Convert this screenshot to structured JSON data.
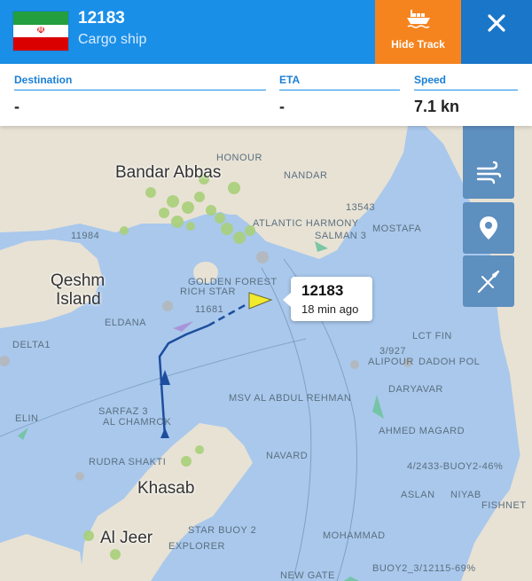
{
  "header": {
    "flag_icon": "iran-flag-icon",
    "title": "12183",
    "subtitle": "Cargo ship",
    "hide_track_label": "Hide Track",
    "hide_track_icon": "cargo-ship-icon",
    "close_icon": "close-icon",
    "colors": {
      "primary": "#1a8fe8",
      "accent": "#f5841f",
      "close_bg": "#1976c9"
    }
  },
  "info": {
    "destination": {
      "label": "Destination",
      "value": "-"
    },
    "eta": {
      "label": "ETA",
      "value": "-"
    },
    "speed": {
      "label": "Speed",
      "value": "7.1 kn"
    }
  },
  "map": {
    "places": {
      "bandar_abbas": "Bandar Abbas",
      "qeshm_1": "Qeshm",
      "qeshm_2": "Island",
      "khasab": "Khasab",
      "al_jeer": "Al Jeer"
    },
    "vessel_labels": [
      "HONOUR",
      "NANDAR",
      "13543",
      "ATLANTIC HARMONY",
      "SALMAN 3",
      "MOSTAFA",
      "GOLDEN FOREST",
      "RICH STAR",
      "11681",
      "ELDANA",
      "DELTA1",
      "LCT FIN",
      "3/927",
      "ALIPOUR",
      "DADOH POL",
      "DARYAVAR",
      "MSV AL ABDUL REHMAN",
      "ELIN",
      "SARFAZ 3",
      "AL CHAMROK",
      "AHMED MAGARD",
      "RUDRA SHAKTI",
      "NAVARD",
      "4/2433-BUOY2-46%",
      "ASLAN",
      "NIYAB",
      "FISHNET",
      "MOHAMMAD",
      "STAR BUOY 2",
      "EXPLORER",
      "NEW GATE",
      "BUOY2_3/12115-69%",
      "11984"
    ],
    "popup": {
      "title": "12183",
      "time": "18 min ago"
    },
    "controls": [
      "wind-icon",
      "location-pin-icon",
      "compass-icon"
    ]
  }
}
